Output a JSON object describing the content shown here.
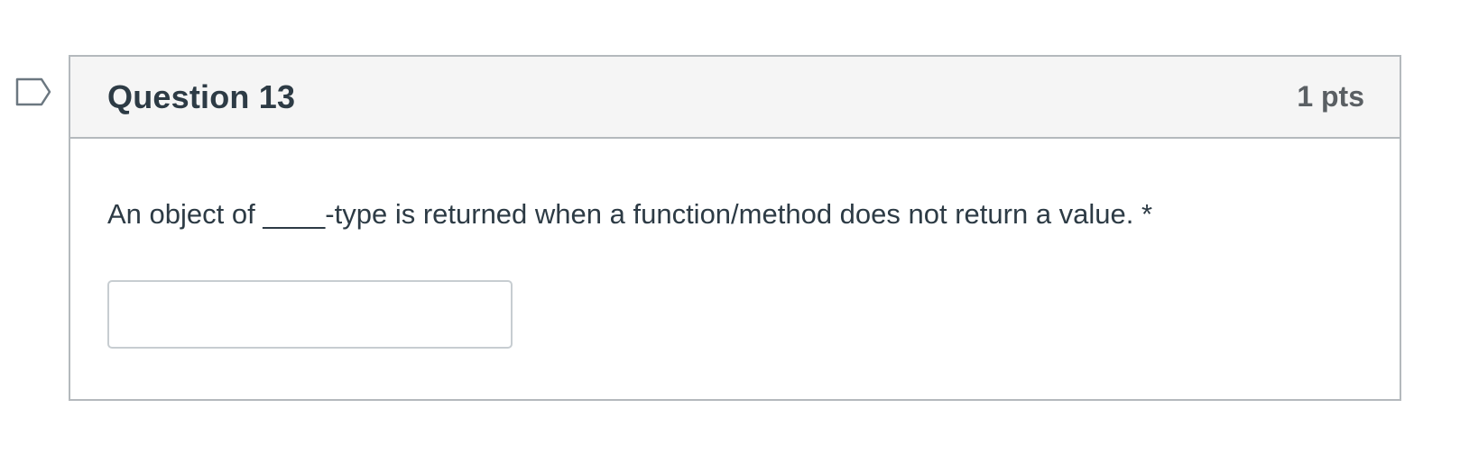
{
  "question": {
    "title": "Question 13",
    "points": "1 pts",
    "text": "An object of ____-type is returned when a function/method does not return a value. *",
    "answer": {
      "value": "",
      "placeholder": ""
    }
  },
  "flag": {
    "icon": "flag-question-icon",
    "state": "unflagged",
    "color": "#6b7780"
  },
  "colors": {
    "header_bg": "#f5f5f5",
    "border": "#b4b9bd",
    "title_text": "#2d3b45",
    "points_text": "#5a5f63",
    "body_text": "#2d3b45"
  }
}
